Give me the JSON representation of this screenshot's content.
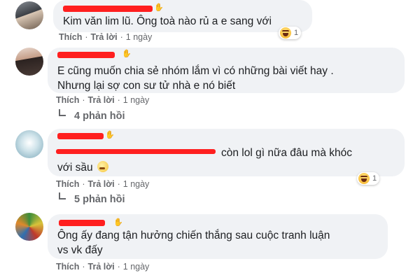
{
  "colors": {
    "redaction": "#ff1f1f",
    "bubble": "#f0f2f5",
    "meta": "#65676b"
  },
  "comments": [
    {
      "text_lines": [
        "Kim văn lim lũ. Ông toà nào rủ a e sang với"
      ],
      "like": "Thích",
      "reply": "Trả lời",
      "time": "1 ngày",
      "reaction_icon": "haha-icon",
      "reaction_count": "1"
    },
    {
      "text_lines": [
        "E cũng muốn chia sẻ nhóm lắm vì có những bài viết hay .",
        "Nhưng lại sợ con sư tử nhà e nó biết"
      ],
      "like": "Thích",
      "reply": "Trả lời",
      "time": "1 ngày",
      "replies": "4 phản hồi"
    },
    {
      "text_lines": [
        "còn lol gì nữa đâu mà khóc",
        "với sầu"
      ],
      "like": "Thích",
      "reply": "Trả lời",
      "time": "1 ngày",
      "reaction_icon": "haha-icon",
      "reaction_count": "1",
      "replies": "5 phản hồi"
    },
    {
      "text_lines": [
        "Ông ấy đang tận hưởng chiến thắng sau cuộc tranh luận",
        "vs vk đấy"
      ],
      "like": "Thích",
      "reply": "Trả lời",
      "time": "1 ngày"
    }
  ]
}
